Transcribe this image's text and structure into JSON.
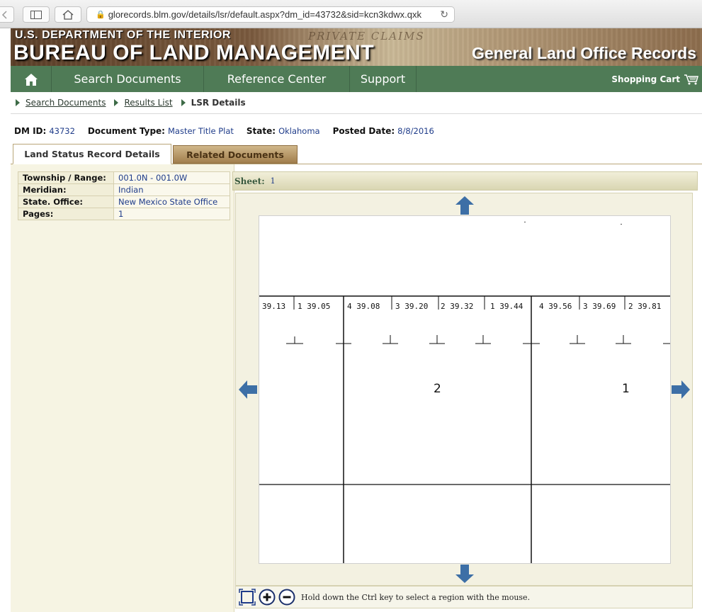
{
  "browser": {
    "url": "glorecords.blm.gov/details/lsr/default.aspx?dm_id=43732&sid=kcn3kdwx.qxk"
  },
  "banner": {
    "department": "U.S. DEPARTMENT OF THE INTERIOR",
    "bureau": "BUREAU OF LAND MANAGEMENT",
    "background_text": "PRIVATE CLAIMS",
    "records_title": "General Land Office Records"
  },
  "nav": {
    "items": [
      {
        "label": "Search Documents"
      },
      {
        "label": "Reference Center"
      },
      {
        "label": "Support"
      }
    ],
    "cart_label": "Shopping Cart"
  },
  "breadcrumb": {
    "items": [
      {
        "label": "Search Documents"
      },
      {
        "label": "Results List"
      },
      {
        "label": "LSR Details"
      }
    ]
  },
  "document": {
    "dm_id_label": "DM ID:",
    "dm_id": "43732",
    "type_label": "Document Type:",
    "type": "Master Title Plat",
    "state_label": "State:",
    "state": "Oklahoma",
    "posted_label": "Posted Date:",
    "posted_date": "8/8/2016"
  },
  "tabs": [
    {
      "label": "Land Status Record Details",
      "active": true
    },
    {
      "label": "Related Documents",
      "active": false
    }
  ],
  "details": {
    "rows": [
      {
        "key": "Township / Range:",
        "value": "001.0N - 001.0W"
      },
      {
        "key": "Meridian:",
        "value": "Indian"
      },
      {
        "key": "State. Office:",
        "value": "New Mexico State Office"
      },
      {
        "key": "Pages:",
        "value": "1"
      }
    ]
  },
  "viewer": {
    "sheet_label": "Sheet:",
    "sheet_value": "1",
    "hint": "Hold down the Ctrl key to select a region with the mouse.",
    "plat": {
      "lot_labels": [
        "39.13",
        "1 39.05",
        "4 39.08",
        "3 39.20",
        "2 39.32",
        "1 39.44",
        "4 39.56",
        "3 39.69",
        "2 39.81"
      ],
      "section_numbers": [
        "2",
        "1"
      ]
    }
  },
  "colors": {
    "nav_green": "#4f7b56",
    "link_blue": "#1f3c8a",
    "arrow_blue": "#3d6fa6"
  }
}
